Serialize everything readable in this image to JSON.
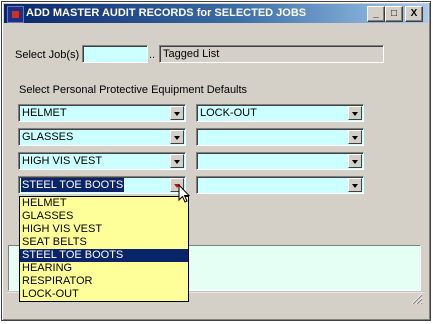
{
  "window": {
    "title": "ADD MASTER AUDIT RECORDS for SELECTED JOBS",
    "controls": [
      "_",
      "□",
      "X"
    ]
  },
  "job_selection": {
    "label": "Select Job(s)",
    "value": "",
    "browse_label": "..",
    "tagged_list_label": "Tagged List"
  },
  "ppe": {
    "section_label": "Select Personal Protective Equipment Defaults",
    "left": [
      "HELMET",
      "GLASSES",
      "HIGH VIS VEST",
      "STEEL TOE BOOTS"
    ],
    "right": [
      "LOCK-OUT",
      "",
      "",
      ""
    ],
    "dropdown_options": [
      "HELMET",
      "GLASSES",
      "HIGH VIS VEST",
      "SEAT BELTS",
      "STEEL TOE BOOTS",
      "HEARING",
      "RESPIRATOR",
      "LOCK-OUT"
    ],
    "dropdown_selected": "STEEL TOE BOOTS"
  },
  "colors": {
    "title_start": "#0a246a",
    "title_end": "#a6caf0",
    "input_bg": "#ccffff",
    "dropdown_bg": "#ffff99",
    "status_bg": "#e6fff5",
    "selection": "#0a246a"
  }
}
